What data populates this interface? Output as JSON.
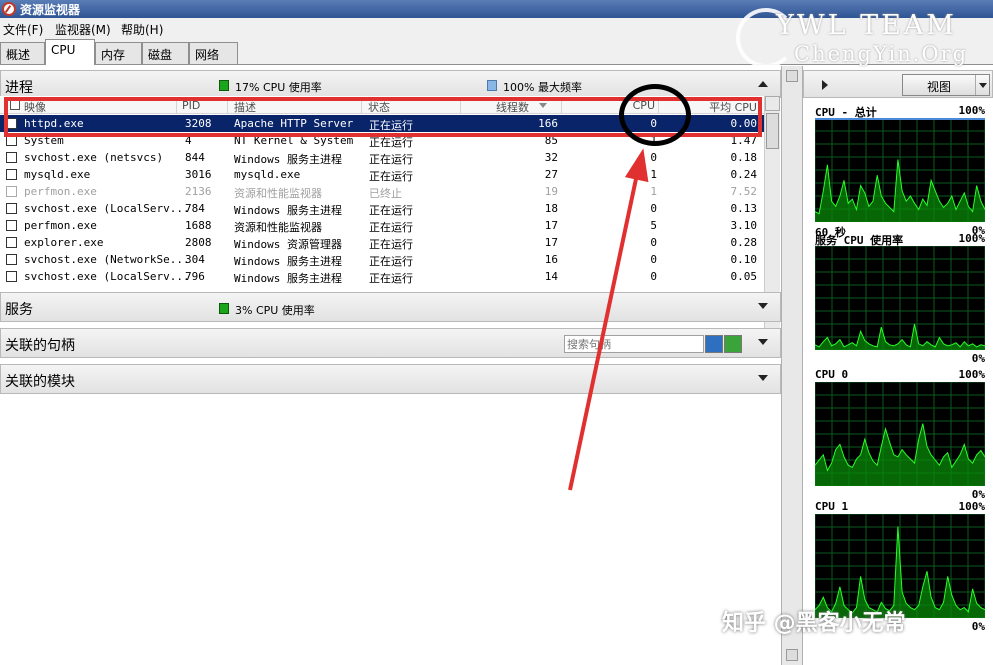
{
  "window": {
    "title": "资源监视器"
  },
  "menu": [
    "文件(F)",
    "监视器(M)",
    "帮助(H)"
  ],
  "tabs": [
    "概述",
    "CPU",
    "内存",
    "磁盘",
    "网络"
  ],
  "active_tab": 1,
  "watermark": {
    "line1": "YWL TEAM",
    "line2": "ChengYin.Org",
    "bottom": "知乎 @黑客小无常"
  },
  "processes": {
    "title": "进程",
    "cpu_usage": "17% CPU 使用率",
    "max_freq": "100% 最大频率",
    "columns": [
      "映像",
      "PID",
      "描述",
      "状态",
      "线程数",
      "CPU",
      "平均 CPU"
    ],
    "rows": [
      {
        "image": "httpd.exe",
        "pid": "3208",
        "desc": "Apache HTTP Server",
        "status": "正在运行",
        "threads": "166",
        "cpu": "0",
        "avg": "0.00",
        "state": "selected"
      },
      {
        "image": "System",
        "pid": "4",
        "desc": "NT Kernel & System",
        "status": "正在运行",
        "threads": "85",
        "cpu": "1",
        "avg": "1.47",
        "state": ""
      },
      {
        "image": "svchost.exe (netsvcs)",
        "pid": "844",
        "desc": "Windows 服务主进程",
        "status": "正在运行",
        "threads": "32",
        "cpu": "0",
        "avg": "0.18",
        "state": ""
      },
      {
        "image": "mysqld.exe",
        "pid": "3016",
        "desc": "mysqld.exe",
        "status": "正在运行",
        "threads": "27",
        "cpu": "1",
        "avg": "0.24",
        "state": ""
      },
      {
        "image": "perfmon.exe",
        "pid": "2136",
        "desc": "资源和性能监视器",
        "status": "已终止",
        "threads": "19",
        "cpu": "1",
        "avg": "7.52",
        "state": "dimmed"
      },
      {
        "image": "svchost.exe (LocalServ...",
        "pid": "784",
        "desc": "Windows 服务主进程",
        "status": "正在运行",
        "threads": "18",
        "cpu": "0",
        "avg": "0.13",
        "state": ""
      },
      {
        "image": "perfmon.exe",
        "pid": "1688",
        "desc": "资源和性能监视器",
        "status": "正在运行",
        "threads": "17",
        "cpu": "5",
        "avg": "3.10",
        "state": ""
      },
      {
        "image": "explorer.exe",
        "pid": "2808",
        "desc": "Windows 资源管理器",
        "status": "正在运行",
        "threads": "17",
        "cpu": "0",
        "avg": "0.28",
        "state": ""
      },
      {
        "image": "svchost.exe (NetworkSe...",
        "pid": "304",
        "desc": "Windows 服务主进程",
        "status": "正在运行",
        "threads": "16",
        "cpu": "0",
        "avg": "0.10",
        "state": ""
      },
      {
        "image": "svchost.exe (LocalServ...",
        "pid": "796",
        "desc": "Windows 服务主进程",
        "status": "正在运行",
        "threads": "14",
        "cpu": "0",
        "avg": "0.05",
        "state": ""
      }
    ]
  },
  "services": {
    "title": "服务",
    "cpu_usage": "3% CPU 使用率"
  },
  "handles": {
    "title": "关联的句柄",
    "search_placeholder": "搜索句柄"
  },
  "modules": {
    "title": "关联的模块"
  },
  "right_panel": {
    "view_label": "视图",
    "graphs": [
      {
        "title": "CPU - 总计",
        "max": "100%",
        "bottom_left": "60 秒",
        "min": "0%",
        "values": [
          10,
          8,
          30,
          55,
          20,
          15,
          25,
          40,
          18,
          22,
          12,
          35,
          28,
          15,
          20,
          45,
          25,
          18,
          14,
          10,
          60,
          30,
          20,
          25,
          18,
          12,
          22,
          16,
          40,
          30,
          20,
          14,
          18,
          25,
          12,
          20,
          28,
          15,
          10,
          35,
          20,
          12
        ]
      },
      {
        "title": "服务 CPU 使用率",
        "max": "100%",
        "min": "0%",
        "values": [
          5,
          3,
          8,
          12,
          4,
          6,
          10,
          3,
          5,
          7,
          4,
          18,
          9,
          6,
          4,
          3,
          22,
          8,
          5,
          4,
          6,
          10,
          5,
          3,
          25,
          6,
          4,
          8,
          5,
          3,
          12,
          6,
          4,
          5,
          7,
          3,
          8,
          4,
          6,
          3,
          5,
          4
        ]
      },
      {
        "title": "CPU 0",
        "max": "100%",
        "min": "0%",
        "values": [
          20,
          25,
          30,
          15,
          22,
          35,
          40,
          28,
          20,
          18,
          26,
          30,
          45,
          32,
          24,
          20,
          38,
          55,
          42,
          30,
          28,
          35,
          30,
          26,
          22,
          45,
          60,
          38,
          30,
          25,
          20,
          28,
          32,
          18,
          24,
          30,
          40,
          26,
          22,
          30,
          34,
          28
        ]
      },
      {
        "title": "CPU 1",
        "max": "100%",
        "min": "0%",
        "values": [
          8,
          12,
          20,
          10,
          6,
          14,
          30,
          12,
          8,
          5,
          10,
          40,
          18,
          10,
          8,
          6,
          15,
          9,
          7,
          12,
          88,
          25,
          14,
          10,
          8,
          12,
          30,
          45,
          20,
          10,
          8,
          15,
          40,
          22,
          12,
          8,
          10,
          6,
          28,
          14,
          10,
          8
        ]
      }
    ]
  }
}
